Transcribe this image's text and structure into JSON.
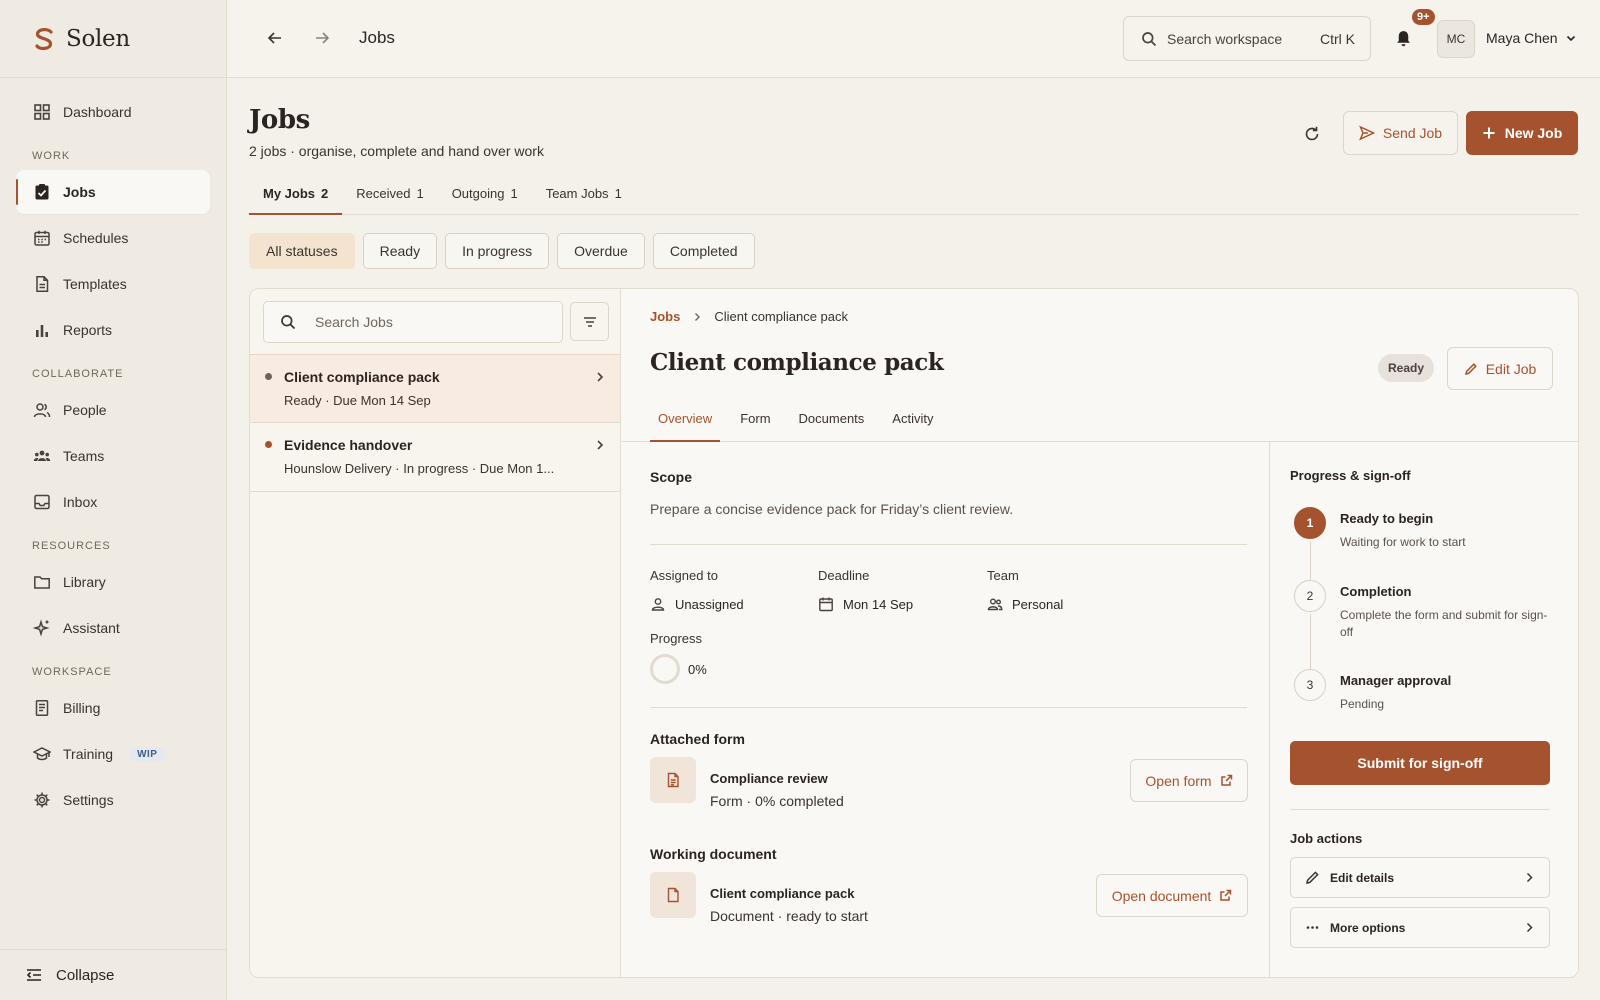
{
  "app": {
    "name": "Solen",
    "brand_color": "#a5532e"
  },
  "sidebar": {
    "top_items": [
      {
        "label": "Dashboard",
        "icon": "grid-icon"
      }
    ],
    "sections": [
      {
        "title": "WORK",
        "items": [
          {
            "label": "Jobs",
            "icon": "clipboard-check-icon",
            "active": true
          },
          {
            "label": "Schedules",
            "icon": "calendar-icon"
          },
          {
            "label": "Templates",
            "icon": "file-icon"
          },
          {
            "label": "Reports",
            "icon": "bar-chart-icon"
          }
        ]
      },
      {
        "title": "COLLABORATE",
        "items": [
          {
            "label": "People",
            "icon": "people-icon"
          },
          {
            "label": "Teams",
            "icon": "team-icon"
          },
          {
            "label": "Inbox",
            "icon": "inbox-icon"
          }
        ]
      },
      {
        "title": "RESOURCES",
        "items": [
          {
            "label": "Library",
            "icon": "folder-icon"
          },
          {
            "label": "Assistant",
            "icon": "sparkle-icon"
          }
        ]
      },
      {
        "title": "WORKSPACE",
        "items": [
          {
            "label": "Billing",
            "icon": "receipt-icon"
          },
          {
            "label": "Training",
            "icon": "graduation-cap-icon",
            "badge": "WIP"
          },
          {
            "label": "Settings",
            "icon": "gear-icon"
          }
        ]
      }
    ],
    "collapse_label": "Collapse"
  },
  "topbar": {
    "title": "Jobs",
    "search_placeholder": "Search workspace",
    "search_shortcut": "Ctrl K",
    "notifications": "9+",
    "user_initials": "MC",
    "user_name": "Maya Chen"
  },
  "page": {
    "title": "Jobs",
    "subtitle": "2 jobs · organise, complete and hand over work",
    "send_label": "Send Job",
    "new_label": "New Job"
  },
  "tabs": [
    {
      "label": "My Jobs",
      "count": "2",
      "active": true
    },
    {
      "label": "Received",
      "count": "1"
    },
    {
      "label": "Outgoing",
      "count": "1"
    },
    {
      "label": "Team Jobs",
      "count": "1"
    }
  ],
  "filters": [
    "All statuses",
    "Ready",
    "In progress",
    "Overdue",
    "Completed"
  ],
  "list": {
    "search_placeholder": "Search Jobs",
    "jobs": [
      {
        "title": "Client compliance pack",
        "meta": "Ready  ·  Due Mon 14 Sep",
        "dot_color": "#6b625a"
      },
      {
        "title": "Evidence handover",
        "meta": "Hounslow Delivery  ·  In progress  ·  Due Mon 1...",
        "dot_color": "#a5532e"
      }
    ]
  },
  "detail": {
    "breadcrumb_root": "Jobs",
    "breadcrumb_current": "Client compliance pack",
    "title": "Client compliance pack",
    "status": "Ready",
    "edit_label": "Edit Job",
    "tabs": [
      "Overview",
      "Form",
      "Documents",
      "Activity"
    ],
    "scope_heading": "Scope",
    "scope_text": "Prepare a concise evidence pack for Friday’s client review.",
    "assigned_label": "Assigned to",
    "assigned_value": "Unassigned",
    "deadline_label": "Deadline",
    "deadline_value": "Mon 14 Sep",
    "team_label": "Team",
    "team_value": "Personal",
    "progress_label": "Progress",
    "progress_value": "0%",
    "attached_heading": "Attached form",
    "form_name": "Compliance review",
    "form_sub": "Form · 0% completed",
    "open_form_label": "Open form",
    "working_heading": "Working document",
    "doc_name": "Client compliance pack",
    "doc_sub": "Document · ready to start",
    "open_doc_label": "Open document"
  },
  "signoff": {
    "heading": "Progress & sign-off",
    "steps": [
      {
        "num": "1",
        "title": "Ready to begin",
        "sub": "Waiting for work to start"
      },
      {
        "num": "2",
        "title": "Completion",
        "sub": "Complete the form and submit for sign-off"
      },
      {
        "num": "3",
        "title": "Manager approval",
        "sub": "Pending"
      }
    ],
    "submit_label": "Submit for sign-off",
    "actions_heading": "Job actions",
    "actions": [
      "Edit details",
      "More options"
    ]
  }
}
